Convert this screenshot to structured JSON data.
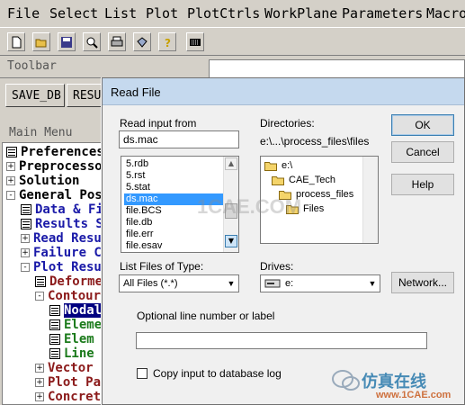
{
  "menubar": {
    "items": [
      "File",
      "Select",
      "List",
      "Plot",
      "PlotCtrls",
      "WorkPlane",
      "Parameters",
      "Macro"
    ]
  },
  "toolbar": {
    "label": "Toolbar",
    "buttons": [
      "SAVE_DB",
      "RESUM"
    ]
  },
  "main_menu": {
    "label": "Main Menu",
    "items": [
      {
        "label": "Preferences",
        "color": "#000000"
      },
      {
        "label": "Preprocessor",
        "color": "#000000"
      },
      {
        "label": "Solution",
        "color": "#000000"
      },
      {
        "label": "General Postproc",
        "color": "#000000"
      },
      {
        "label": "Data & File Opts",
        "color": "#1a1aa8"
      },
      {
        "label": "Results Summary",
        "color": "#1a1aa8"
      },
      {
        "label": "Read Results",
        "color": "#1a1aa8"
      },
      {
        "label": "Failure Criteria",
        "color": "#1a1aa8"
      },
      {
        "label": "Plot Results",
        "color": "#1a1aa8"
      },
      {
        "label": "Deformed Shape",
        "color": "#8b1a1a"
      },
      {
        "label": "Contour Plot",
        "color": "#8b1a1a"
      },
      {
        "label": "Nodal Solu",
        "color": "#ffffff"
      },
      {
        "label": "Element Solu",
        "color": "#1a7a1a"
      },
      {
        "label": "Elem Table",
        "color": "#1a7a1a"
      },
      {
        "label": "Line Elem Res",
        "color": "#1a7a1a"
      },
      {
        "label": "Vector Plot",
        "color": "#8b1a1a"
      },
      {
        "label": "Plot Path Item",
        "color": "#8b1a1a"
      },
      {
        "label": "Concrete Plot",
        "color": "#8b1a1a"
      }
    ]
  },
  "dialog": {
    "title": "Read File",
    "read_input_label": "Read input from",
    "filename_value": "ds.mac",
    "files": [
      "5.rdb",
      "5.rst",
      "5.stat",
      "ds.mac",
      "file.BCS",
      "file.db",
      "file.err",
      "file.esav"
    ],
    "selected_file": "ds.mac",
    "directories_label": "Directories:",
    "current_path": "e:\\...\\process_files\\files",
    "directory_tree": [
      "e:\\",
      "CAE_Tech",
      "process_files",
      "Files"
    ],
    "file_type_label": "List Files of Type:",
    "file_type_value": "All Files (*.*)",
    "drives_label": "Drives:",
    "drive_value": "e:",
    "ok_label": "OK",
    "cancel_label": "Cancel",
    "help_label": "Help",
    "network_label": "Network...",
    "optional_label": "Optional line number or label",
    "optional_value": "",
    "copy_label": "Copy input to database log",
    "copy_checked": false
  },
  "watermark": {
    "brand": "仿真在线",
    "url": "www.1CAE.com",
    "center": "1CAE.COM"
  }
}
